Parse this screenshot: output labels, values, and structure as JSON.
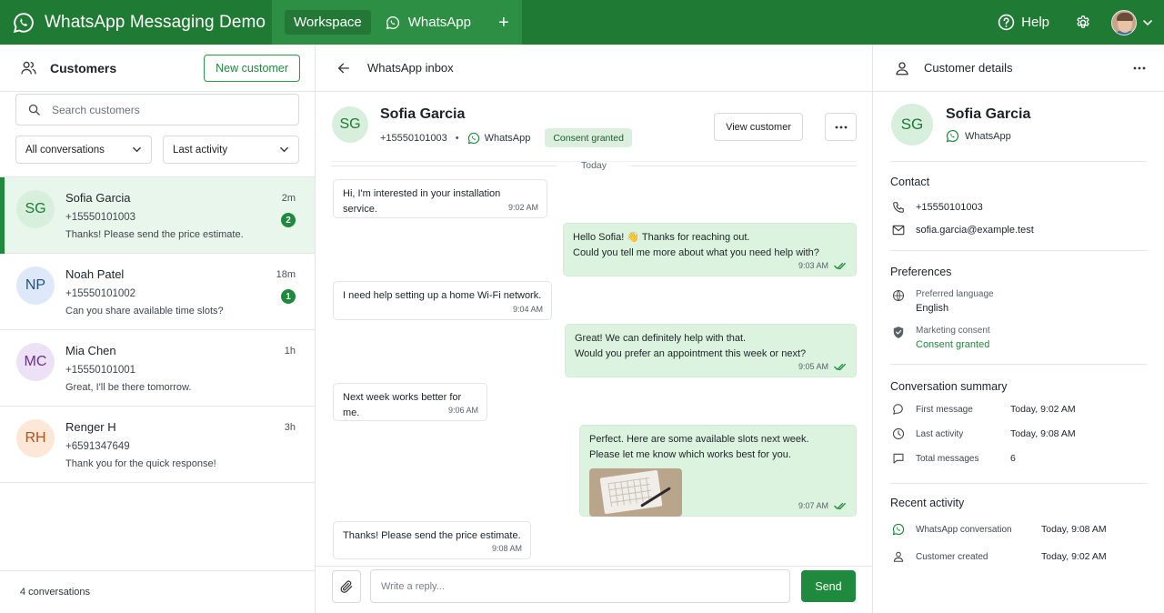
{
  "app": {
    "title": "WhatsApp Messaging Demo",
    "tabs": [
      {
        "label": "Workspace",
        "active": true
      },
      {
        "label": "WhatsApp",
        "active": false
      }
    ],
    "add_tab_symbol": "+",
    "help_label": "Help",
    "brand_color": "#1f7a34",
    "accent_color": "#1f8a3d"
  },
  "sidebar": {
    "title": "Customers",
    "new_customer_label": "New customer",
    "search_placeholder": "Search customers",
    "filter_conversations": "All conversations",
    "filter_sort": "Last activity",
    "conversations": [
      {
        "initials": "SG",
        "name": "Sofia Garcia",
        "phone": "+15550101003",
        "preview": "Thanks! Please send the price estimate.",
        "time": "2m",
        "unread": "2",
        "active": true
      },
      {
        "initials": "NP",
        "name": "Noah Patel",
        "phone": "+15550101002",
        "preview": "Can you share available time slots?",
        "time": "18m",
        "unread": "1",
        "active": false
      },
      {
        "initials": "MC",
        "name": "Mia Chen",
        "phone": "+15550101001",
        "preview": "Great, I'll be there tomorrow.",
        "time": "1h",
        "unread": "",
        "active": false
      },
      {
        "initials": "RH",
        "name": "Renger H",
        "phone": "+6591347649",
        "preview": "Thank you for the quick response!",
        "time": "3h",
        "unread": "",
        "active": false
      }
    ],
    "footer": "4 conversations"
  },
  "inbox": {
    "title": "WhatsApp inbox",
    "contact": {
      "initials": "SG",
      "name": "Sofia Garcia",
      "phone": "+15550101003",
      "channel": "WhatsApp",
      "consent": "Consent granted"
    },
    "view_customer_label": "View customer",
    "date_divider": "Today",
    "messages": [
      {
        "direction": "in",
        "lines": [
          "Hi, I'm interested in your installation service."
        ],
        "time": "9:02 AM"
      },
      {
        "direction": "out",
        "lines": [
          "Hello Sofia! 👋 Thanks for reaching out.",
          "Could you tell me more about what you need help with?"
        ],
        "time": "9:03 AM"
      },
      {
        "direction": "in",
        "lines": [
          "I need help setting up a home Wi-Fi network."
        ],
        "time": "9:04 AM"
      },
      {
        "direction": "out",
        "lines": [
          "Great! We can definitely help with that.",
          "Would you prefer an appointment this week or next?"
        ],
        "time": "9:05 AM"
      },
      {
        "direction": "in",
        "lines": [
          "Next week works better for me."
        ],
        "time": "9:06 AM"
      },
      {
        "direction": "out",
        "lines": [
          "Perfect. Here are some available slots next week.",
          "Please let me know which works best for you."
        ],
        "time": "9:07 AM",
        "attachment": "calendar-photo"
      },
      {
        "direction": "in",
        "lines": [
          "Thanks! Please send the price estimate."
        ],
        "time": "9:08 AM"
      }
    ],
    "reply_placeholder": "Write a reply...",
    "send_label": "Send"
  },
  "details": {
    "title": "Customer details",
    "initials": "SG",
    "name": "Sofia Garcia",
    "channel": "WhatsApp",
    "contact_title": "Contact",
    "phone": "+15550101003",
    "email": "sofia.garcia@example.test",
    "preferences_title": "Preferences",
    "language_label": "Preferred language",
    "language_value": "English",
    "consent_label": "Marketing consent",
    "consent_value": "Consent granted",
    "summary_title": "Conversation summary",
    "summary": [
      {
        "label": "First message",
        "value": "Today, 9:02 AM"
      },
      {
        "label": "Last activity",
        "value": "Today, 9:08 AM"
      },
      {
        "label": "Total messages",
        "value": "6"
      }
    ],
    "activity_title": "Recent activity",
    "activity": [
      {
        "label": "WhatsApp conversation",
        "value": "Today, 9:08 AM"
      },
      {
        "label": "Customer created",
        "value": "Today, 9:02 AM"
      }
    ]
  }
}
